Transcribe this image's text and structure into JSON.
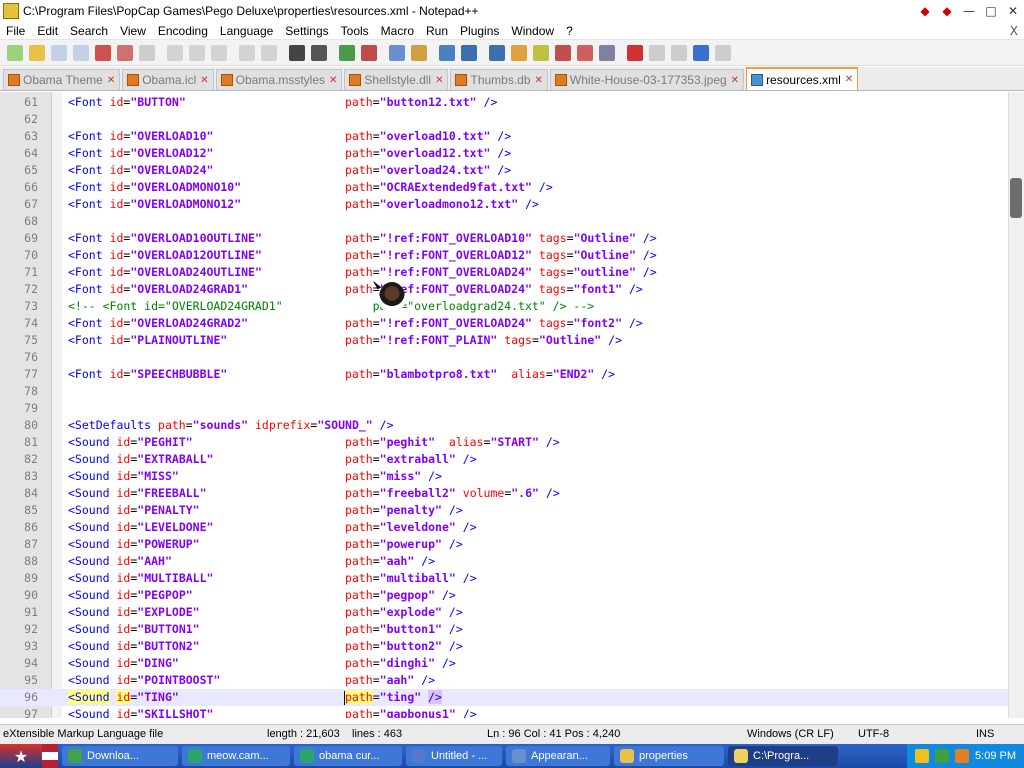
{
  "window": {
    "title": "C:\\Program Files\\PopCap Games\\Pego Deluxe\\properties\\resources.xml - Notepad++",
    "controls": [
      "—",
      "□",
      "✕"
    ],
    "menu_close": "X"
  },
  "menu": [
    "File",
    "Edit",
    "Search",
    "View",
    "Encoding",
    "Language",
    "Settings",
    "Tools",
    "Macro",
    "Run",
    "Plugins",
    "Window",
    "?"
  ],
  "tabs": [
    {
      "label": "Obama Theme",
      "active": false
    },
    {
      "label": "Obama.icl",
      "active": false
    },
    {
      "label": "Obama.msstyles",
      "active": false
    },
    {
      "label": "Shellstyle.dll",
      "active": false
    },
    {
      "label": "Thumbs.db",
      "active": false
    },
    {
      "label": "White-House-03-177353.jpeg",
      "active": false
    },
    {
      "label": "resources.xml",
      "active": true
    }
  ],
  "code_lines": [
    {
      "n": "61",
      "pre": "",
      "id": "BUTTON",
      "path": "button12.txt",
      "extra": "",
      "kind": "font"
    },
    {
      "n": "62",
      "kind": "blank"
    },
    {
      "n": "63",
      "id": "OVERLOAD10",
      "path": "overload10.txt",
      "kind": "font"
    },
    {
      "n": "64",
      "id": "OVERLOAD12",
      "path": "overload12.txt",
      "kind": "font"
    },
    {
      "n": "65",
      "id": "OVERLOAD24",
      "path": "overload24.txt",
      "kind": "font"
    },
    {
      "n": "66",
      "id": "OVERLOADMONO10",
      "path": "OCRAExtended9fat.txt",
      "kind": "font"
    },
    {
      "n": "67",
      "id": "OVERLOADMONO12",
      "path": "overloadmono12.txt",
      "kind": "font"
    },
    {
      "n": "68",
      "kind": "blank"
    },
    {
      "n": "69",
      "id": "OVERLOAD10OUTLINE",
      "path": "!ref:FONT_OVERLOAD10",
      "tags": "Outline",
      "kind": "fonttag"
    },
    {
      "n": "70",
      "id": "OVERLOAD12OUTLINE",
      "path": "!ref:FONT_OVERLOAD12",
      "tags": "Outline",
      "kind": "fonttag"
    },
    {
      "n": "71",
      "id": "OVERLOAD24OUTLINE",
      "path": "!ref:FONT_OVERLOAD24",
      "tags": "outline",
      "kind": "fonttag"
    },
    {
      "n": "72",
      "id": "OVERLOAD24GRAD1",
      "path": "!ref:FONT_OVERLOAD24",
      "tags": "font1",
      "kind": "fonttag"
    },
    {
      "n": "73",
      "text": "<!-- <Font id=\"OVERLOAD24GRAD1\"             path=\"overloadgrad24.txt\" /> -->",
      "kind": "comment"
    },
    {
      "n": "74",
      "id": "OVERLOAD24GRAD2",
      "path": "!ref:FONT_OVERLOAD24",
      "tags": "font2",
      "kind": "fonttag"
    },
    {
      "n": "75",
      "id": "PLAINOUTLINE",
      "path": "!ref:FONT_PLAIN",
      "tags": "Outline",
      "kind": "fonttag"
    },
    {
      "n": "76",
      "kind": "blank"
    },
    {
      "n": "77",
      "id": "SPEECHBUBBLE",
      "path": "blambotpro8.txt",
      "alias": "END2",
      "kind": "fontalias"
    },
    {
      "n": "78",
      "kind": "blank"
    },
    {
      "n": "79",
      "kind": "blank"
    },
    {
      "n": "80",
      "kind": "setdefaults",
      "path": "sounds",
      "idprefix": "SOUND_"
    },
    {
      "n": "81",
      "id": "PEGHIT",
      "path": "peghit",
      "alias": "START",
      "kind": "soundalias"
    },
    {
      "n": "82",
      "id": "EXTRABALL",
      "path": "extraball",
      "kind": "sound"
    },
    {
      "n": "83",
      "id": "MISS",
      "path": "miss",
      "kind": "sound"
    },
    {
      "n": "84",
      "id": "FREEBALL",
      "path": "freeball2",
      "volume": ".6",
      "kind": "soundvol"
    },
    {
      "n": "85",
      "id": "PENALTY",
      "path": "penalty",
      "kind": "sound"
    },
    {
      "n": "86",
      "id": "LEVELDONE",
      "path": "leveldone",
      "kind": "sound"
    },
    {
      "n": "87",
      "id": "POWERUP",
      "path": "powerup",
      "kind": "sound"
    },
    {
      "n": "88",
      "id": "AAH",
      "path": "aah",
      "kind": "sound"
    },
    {
      "n": "89",
      "id": "MULTIBALL",
      "path": "multiball",
      "kind": "sound"
    },
    {
      "n": "90",
      "id": "PEGPOP",
      "path": "pegpop",
      "kind": "sound"
    },
    {
      "n": "91",
      "id": "EXPLODE",
      "path": "explode",
      "kind": "sound"
    },
    {
      "n": "92",
      "id": "BUTTON1",
      "path": "button1",
      "kind": "sound"
    },
    {
      "n": "93",
      "id": "BUTTON2",
      "path": "button2",
      "kind": "sound"
    },
    {
      "n": "94",
      "id": "DING",
      "path": "dinghi",
      "kind": "sound"
    },
    {
      "n": "95",
      "id": "POINTBOOST",
      "path": "aah",
      "kind": "sound"
    },
    {
      "n": "96",
      "id": "TING",
      "path": "ting",
      "kind": "sound",
      "current": true
    },
    {
      "n": "97",
      "id": "SKILLSHOT",
      "path": "gapbonus1",
      "kind": "sound"
    }
  ],
  "status": {
    "file_type": "eXtensible Markup Language file",
    "length": "length : 21,603",
    "lines": "lines : 463",
    "position": "Ln : 96    Col : 41    Pos : 4,240",
    "eol": "Windows (CR LF)",
    "encoding": "UTF-8",
    "mode": "INS"
  },
  "taskbar": {
    "tasks": [
      {
        "label": "Downloa...",
        "color": "#3fa34d"
      },
      {
        "label": "meow.cam...",
        "color": "#2ca56b"
      },
      {
        "label": "obama cur...",
        "color": "#2ca56b"
      },
      {
        "label": "Untitled - ...",
        "color": "#5577cc"
      },
      {
        "label": "Appearan...",
        "color": "#6a8fcf"
      },
      {
        "label": "properties",
        "color": "#e8c04a"
      },
      {
        "label": "C:\\Progra...",
        "color": "#f0d060",
        "active": true
      }
    ],
    "clock": "5:09 PM"
  },
  "colors": {
    "tag": "#0000ff",
    "attr": "#ff0000",
    "value": "#8000ff",
    "comment": "#008000",
    "active_tab_accent": "#ff9a3c"
  },
  "icons": [
    "notepadpp-app-icon",
    "favorite-icon",
    "start-icon",
    "tray-shield-icon",
    "tray-network-icon",
    "tray-volume-icon"
  ]
}
